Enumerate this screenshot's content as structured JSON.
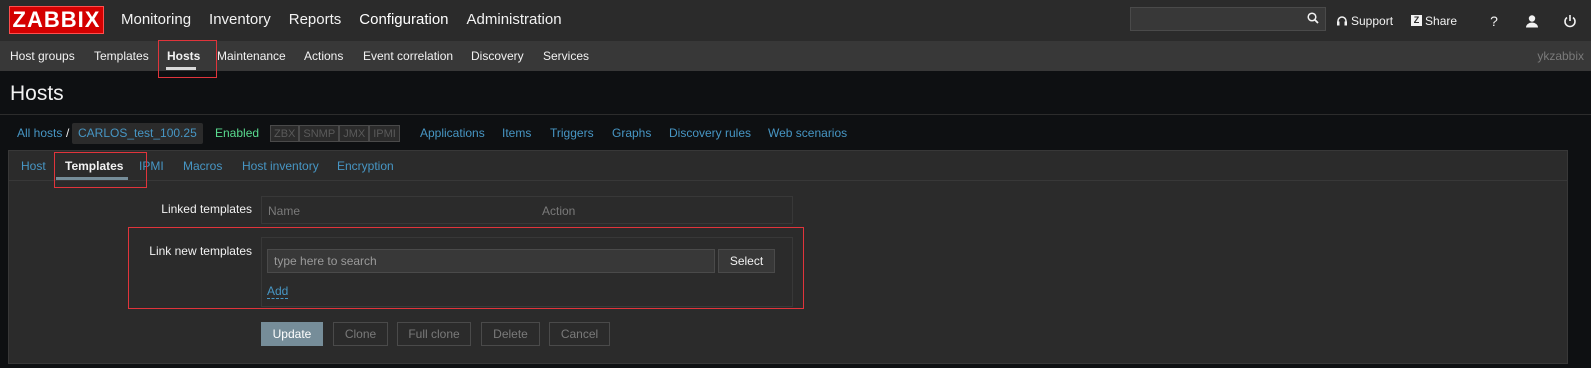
{
  "brand": {
    "logo": "ZABBIX",
    "accent_color": "#d40000"
  },
  "main_menu": {
    "items": [
      "Monitoring",
      "Inventory",
      "Reports",
      "Configuration",
      "Administration"
    ],
    "active": "Configuration"
  },
  "search": {
    "placeholder": "",
    "value": ""
  },
  "header_links": {
    "support": "Support",
    "share": "Share",
    "help": "?"
  },
  "sub_menu": {
    "items": [
      "Host groups",
      "Templates",
      "Hosts",
      "Maintenance",
      "Actions",
      "Event correlation",
      "Discovery",
      "Services"
    ],
    "active": "Hosts",
    "username": "ykzabbix"
  },
  "page": {
    "title": "Hosts"
  },
  "breadcrumbs": {
    "all_hosts": "All hosts",
    "separator": "/",
    "host_name": "CARLOS_test_100.25",
    "status": "Enabled",
    "availability": [
      "ZBX",
      "SNMP",
      "JMX",
      "IPMI"
    ],
    "links": [
      "Applications",
      "Items",
      "Triggers",
      "Graphs",
      "Discovery rules",
      "Web scenarios"
    ]
  },
  "tabs": {
    "items": [
      "Host",
      "Templates",
      "IPMI",
      "Macros",
      "Host inventory",
      "Encryption"
    ],
    "active": "Templates"
  },
  "form": {
    "linked_templates_label": "Linked templates",
    "linked_columns": [
      "Name",
      "Action"
    ],
    "link_new_label": "Link new templates",
    "new_template_placeholder": "type here to search",
    "select_button": "Select",
    "add_link": "Add"
  },
  "buttons": {
    "update": "Update",
    "clone": "Clone",
    "full_clone": "Full clone",
    "delete": "Delete",
    "cancel": "Cancel"
  },
  "colors": {
    "link": "#4796c4",
    "enabled": "#59db8f",
    "highlight_border": "#e0343b",
    "primary_button": "#768d99"
  }
}
